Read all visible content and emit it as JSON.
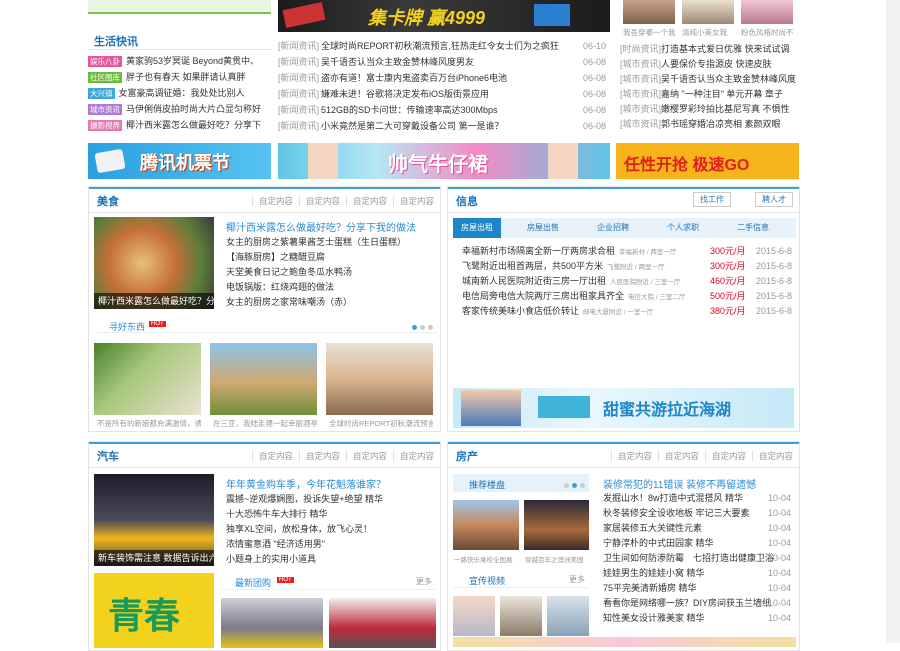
{
  "top": {
    "life_title": "生活快讯",
    "life_items": [
      {
        "tag": "娱乐八卦",
        "color": "#e4589a",
        "text": "黄家驹53岁冥诞 Beyond黄贯中、"
      },
      {
        "tag": "社区图库",
        "color": "#6cbb3c",
        "text": "胖子也有春天 如果胖请认真胖"
      },
      {
        "tag": "大兴镇",
        "color": "#3aa8d8",
        "text": "女富豪高调征婚：我处处比别人"
      },
      {
        "tag": "城市资讯",
        "color": "#b07ad8",
        "text": "马伊俐俏皮拍时尚大片凸显匀称好"
      },
      {
        "tag": "摄影视界",
        "color": "#e47ab0",
        "text": "椰汁西米露怎么做最好吃？分享下"
      }
    ],
    "center_banner": "集卡牌 赢4999",
    "news": [
      {
        "cat": "[新闻资讯]",
        "text": "全球时尚REPORT初秋潮流预言,狂热走红令女士们为之疯狂",
        "date": "06-10"
      },
      {
        "cat": "[新闻资讯]",
        "text": "吴千语否认当众主致金赞林峰风度男友",
        "date": "06-08"
      },
      {
        "cat": "[新闻资讯]",
        "text": "盗亦有道！富士康内鬼盗卖百万台iPhone6电池",
        "date": "06-08"
      },
      {
        "cat": "[新闻资讯]",
        "text": "嫌难未进！谷歌将决定发布iOS版街景应用",
        "date": "06-08"
      },
      {
        "cat": "[新闻资讯]",
        "text": "512GB的SD卡问世：传输速率高达300Mbps",
        "date": "06-08"
      },
      {
        "cat": "[新闻资讯]",
        "text": "小米竟然是第二大可穿戴设备公司 第一是谁？",
        "date": "06-08"
      }
    ],
    "right_captions": [
      "我吾穿哪一个我",
      "清纯小美女我",
      "粉色风格时尚不"
    ],
    "right_news": [
      {
        "cat": "[时尚资讯]",
        "text": "打造基本式爱日优雅 快来试试调"
      },
      {
        "cat": "[城市资讯]",
        "text": "人要保价专指源皮 快速皮肤"
      },
      {
        "cat": "[城市资讯]",
        "text": "吴千语否认当众主致金赞林峰风度"
      },
      {
        "cat": "[城市资讯]",
        "text": "嘉纳 \"一种注目\" 单元开幕 章子"
      },
      {
        "cat": "[城市资讯]",
        "text": "嫩樱罗彩玲拍比基尼写真 不惧性"
      },
      {
        "cat": "[城市资讯]",
        "text": "郭书瑶穿婚冶凉亮相 素颜双眼"
      }
    ]
  },
  "banners": [
    "腾讯机票节",
    "帅气牛仔裙",
    "任性开抢 极速GO"
  ],
  "food": {
    "title": "美食",
    "links": [
      "自定内容",
      "自定内容",
      "自定内容",
      "自定内容"
    ],
    "main_caption": "椰汁西米露怎么做最好吃？分",
    "headline": "椰汁西米露怎么做最好吃？分享下我的做法",
    "items": [
      "女主的厨房之紫薯果酱芝士蛋糕（生日蛋糕）",
      "【海豚厨房】之糖醋豆腐",
      "天堂美食日记之鲍鱼冬瓜水鸭汤",
      "电饭锅版：红烧鸡翅的做法",
      "女主的厨房之家常味嘲汤（赤）"
    ],
    "sub_title": "寻好东西",
    "hot": "HOT",
    "photos": [
      "不是所有的新娘都充满激情，诱",
      "在三亚，我陆走建一起幸丽酒亭",
      "全球时尚REPORT初秋潮流预言"
    ]
  },
  "info": {
    "title": "信息",
    "btn1": "找工作",
    "btn2": "聘人才",
    "tabs": [
      "房屋出租",
      "房屋出售",
      "企业招聘",
      "个人求职",
      "二手信息"
    ],
    "rows": [
      {
        "text": "幸福新村市场隔离全新一厅两房求合租",
        "loc": "幸福新村 / 两室一厅",
        "price": "300元/月",
        "date": "2015-6-8"
      },
      {
        "text": "飞鹭附近出租首两层，共500平方米",
        "loc": "飞鹭附近 / 两室一厅",
        "price": "300元/月",
        "date": "2015-6-8"
      },
      {
        "text": "城南新人民医院附近街三房一厅出租",
        "loc": "人民医院附近 / 三室一厅",
        "price": "460元/月",
        "date": "2015-6-8"
      },
      {
        "text": "电信局旁电信大院两厅三房出租家具齐全",
        "loc": "电信大院 / 三室二厅",
        "price": "500元/月",
        "date": "2015-6-8"
      },
      {
        "text": "客家传统美味小食店低价转让",
        "loc": "邮电大厦附近 / 一室一厅",
        "price": "380元/月",
        "date": "2015-6-8"
      }
    ],
    "ad": "甜蜜共游拉近海湖"
  },
  "car": {
    "title": "汽车",
    "links": [
      "自定内容",
      "自定内容",
      "自定内容",
      "自定内容"
    ],
    "main_caption": "新车装饰需注意 数据告诉出六大傻",
    "headline": "年年黄金购车季，今年花魁落谁家？",
    "items": [
      "震撼~逆观爆娴图，投诉失望+绝望 精华",
      "十大恐怖牛车大排行 精华",
      "独享XL空间，放松身体，放飞心灵！",
      "浓情蜜意酒 \"经济适用男\"",
      "小题身上的实用小道具"
    ],
    "img2_text": "青春",
    "sub_title": "最新团购",
    "more": "更多",
    "hot": "HOT"
  },
  "house": {
    "title": "房产",
    "links": [
      "自定内容",
      "自定内容",
      "自定内容",
      "自定内容"
    ],
    "rec_title": "推荐楼盘",
    "photos": [
      "一路快乐乘校全国展",
      "穿越百年之澳洲美国"
    ],
    "video_title": "宣传视频",
    "more": "更多",
    "headline": "装修常犯的11错误 装修不再留遗憾",
    "items": [
      {
        "text": "发掘山水！8w打造中式混搭风 精华",
        "date": "10-04"
      },
      {
        "text": "秋冬装修安全设收地板 牢记三大要素",
        "date": "10-04"
      },
      {
        "text": "家居装修五大关键性元素",
        "date": "10-04"
      },
      {
        "text": "宁静淳朴的中式田园家 精华",
        "date": "10-04"
      },
      {
        "text": "卫生间如何防渗防霉　七招打造出健康卫浴",
        "date": "10-04"
      },
      {
        "text": "娃娃男生的娃娃小窝 精华",
        "date": "10-04"
      },
      {
        "text": "75平完美清新婚房 精华",
        "date": "10-04"
      },
      {
        "text": "看看你是网络哪一族？DIY房间获玉兰墙纸",
        "date": "10-04"
      },
      {
        "text": "知性美女设计雅美家 精华",
        "date": "10-04"
      }
    ]
  }
}
